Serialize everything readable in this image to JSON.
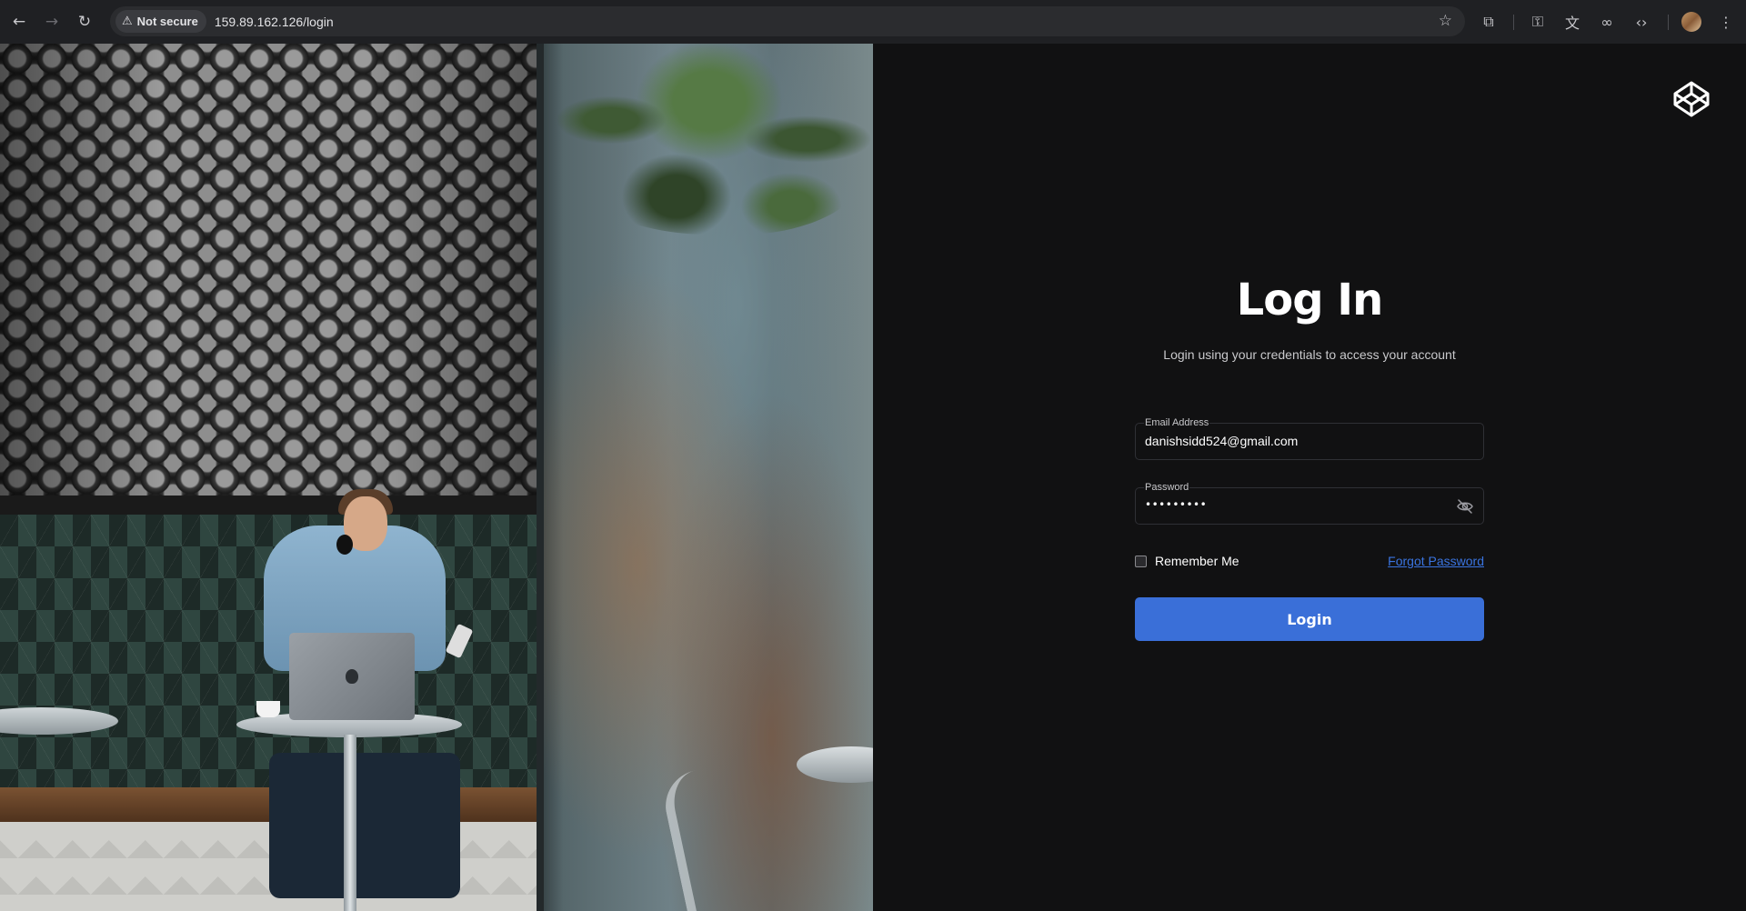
{
  "browser": {
    "security_label": "Not secure",
    "url": "159.89.162.126/login",
    "icons": [
      "back-arrow-icon",
      "forward-arrow-icon",
      "reload-icon",
      "warning-icon",
      "star-icon",
      "extensions-icon",
      "password-key-icon",
      "translate-icon",
      "link-icon",
      "code-icon",
      "profile-avatar",
      "menu-icon"
    ]
  },
  "hero": {
    "description_icon": "photo"
  },
  "login": {
    "logo_icon": "codepen-logo-icon",
    "title": "Log In",
    "subtitle": "Login using your credentials to access your account",
    "email_label": "Email Address",
    "email_value": "danishsidd524@gmail.com",
    "password_label": "Password",
    "password_mask": "•••••••••",
    "remember_label": "Remember Me",
    "forgot_label": "Forgot Password",
    "button_label": "Login"
  },
  "colors": {
    "background": "#111112",
    "accent": "#3a6fd8",
    "link": "#3a74e0"
  }
}
